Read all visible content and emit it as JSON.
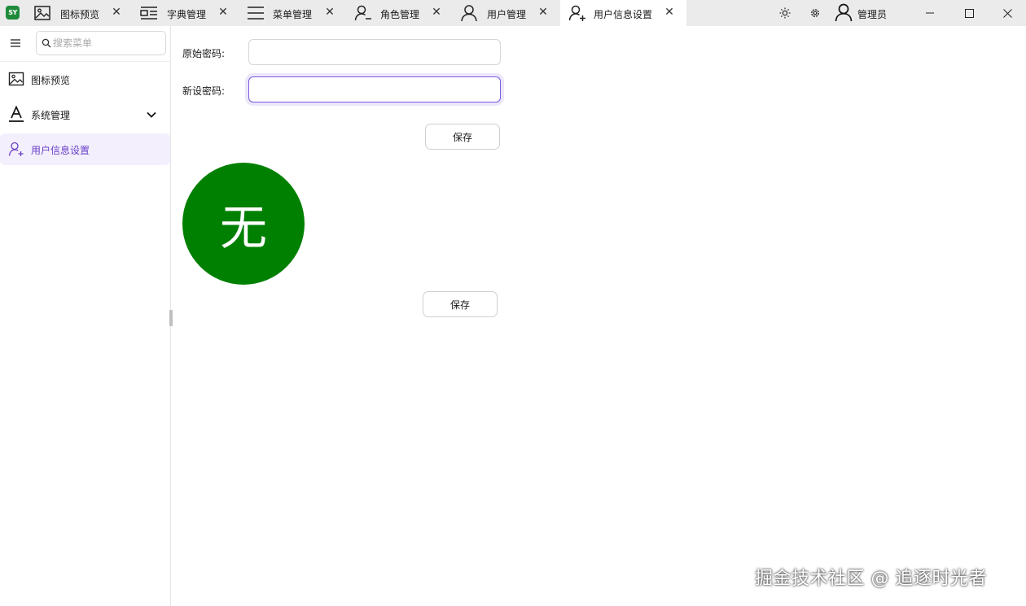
{
  "app": {
    "logo_text": "SY"
  },
  "tabs": [
    {
      "label": "图标预览",
      "icon": "image-icon"
    },
    {
      "label": "字典管理",
      "icon": "dictionary-icon"
    },
    {
      "label": "菜单管理",
      "icon": "menu-lines-icon"
    },
    {
      "label": "角色管理",
      "icon": "role-icon"
    },
    {
      "label": "用户管理",
      "icon": "user-icon"
    },
    {
      "label": "用户信息设置",
      "icon": "user-settings-icon",
      "active": true
    }
  ],
  "toolbar": {
    "theme_icon": "sun-icon",
    "settings_icon": "gear-icon"
  },
  "user": {
    "name": "管理员",
    "icon": "user-avatar-icon"
  },
  "window_controls": [
    "minimize-icon",
    "maximize-icon",
    "close-icon"
  ],
  "sidebar": {
    "search_placeholder": "搜索菜单",
    "items": [
      {
        "label": "图标预览",
        "icon": "image-icon"
      },
      {
        "label": "系统管理",
        "icon": "font-a-icon",
        "expandable": true
      },
      {
        "label": "用户信息设置",
        "icon": "user-settings-icon",
        "active": true
      }
    ]
  },
  "form": {
    "old_password_label": "原始密码:",
    "old_password_value": "",
    "new_password_label": "新设密码:",
    "new_password_value": "",
    "save_label": "保存"
  },
  "avatar": {
    "text": "无",
    "color": "#008000",
    "save_label": "保存"
  },
  "colors": {
    "accent": "#7b5be0",
    "active_bg": "#f3effc",
    "titlebar_bg": "#ebebeb"
  },
  "watermark": "掘金技术社区 @ 追逐时光者"
}
